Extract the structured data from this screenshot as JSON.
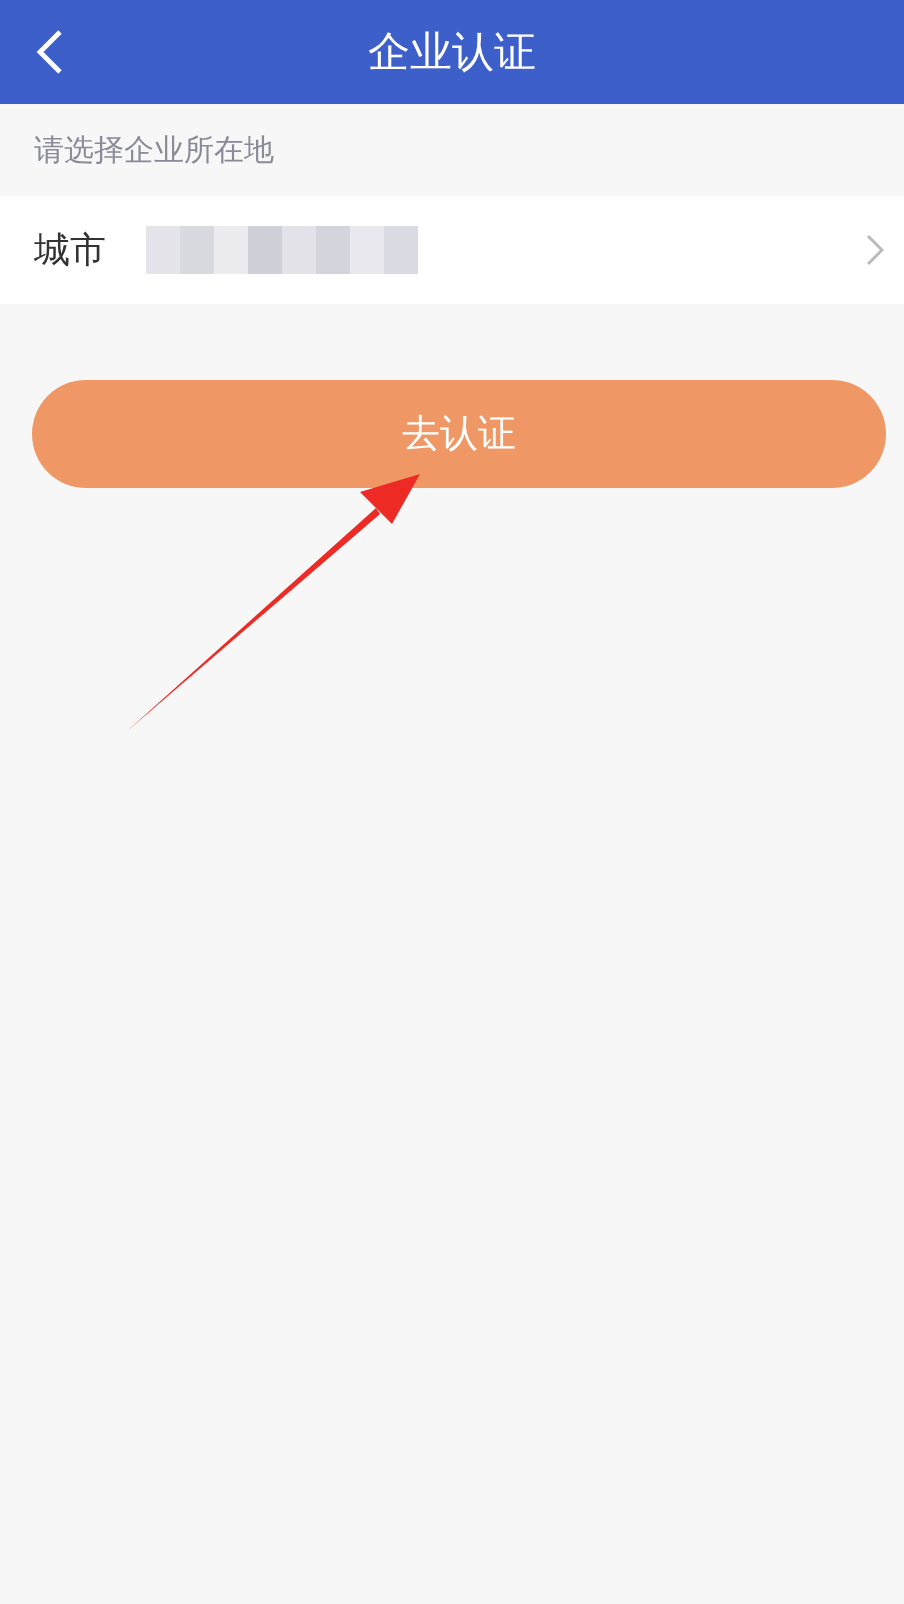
{
  "header": {
    "title": "企业认证"
  },
  "section_label": "请选择企业所在地",
  "city_row": {
    "label": "城市",
    "value_redacted": true
  },
  "submit_button": {
    "label": "去认证"
  },
  "annotation": {
    "kind": "arrow",
    "color": "#ee2a24"
  }
}
